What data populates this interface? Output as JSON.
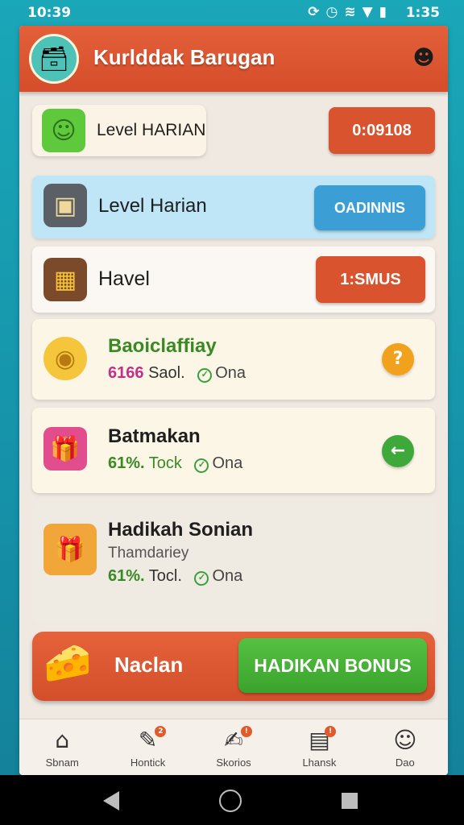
{
  "status_bar": {
    "time_left": "10:39",
    "time_right": "1:35",
    "icons": [
      "sync-icon",
      "alarm-icon",
      "wifi-icon",
      "signal-icon",
      "battery-icon"
    ]
  },
  "header": {
    "title": "Kurlddak Barugan",
    "logo_icon": "treasure-logo-icon",
    "profile_icon": "ninja-avatar-icon"
  },
  "row1": {
    "label": "Level HARIAN",
    "button": "0:09108",
    "icon": "green-cube-icon"
  },
  "row2": {
    "label": "Level Harian",
    "button": "OADINNIS",
    "icon": "tablet-icon"
  },
  "row3": {
    "label": "Havel",
    "button": "1:SMUS",
    "icon": "blocks-icon"
  },
  "cards": [
    {
      "title": "Baoiclaffiay",
      "subtitle": "",
      "pct": "6166",
      "pct_text": "Saol.",
      "status": "Ona",
      "action": "?",
      "icon": "golden-egg-icon"
    },
    {
      "title": "Batmakan",
      "subtitle": "",
      "pct": "61%.",
      "pct_text": "Tock",
      "status": "Ona",
      "action": "←",
      "icon": "gift-box-icon"
    },
    {
      "title": "Hadikah Sonian",
      "subtitle": "Thamdariey",
      "pct": "61%.",
      "pct_text": "Tocl.",
      "status": "Ona",
      "icon": "gift-pile-icon"
    }
  ],
  "banner": {
    "label": "Naclan",
    "button": "HADIKAN BONUS",
    "icon": "cheese-bonus-icon"
  },
  "bottom_nav": [
    {
      "label": "Sbnam",
      "icon": "home-icon"
    },
    {
      "label": "Hontick",
      "icon": "edit-box-icon",
      "badge": "2"
    },
    {
      "label": "Skorios",
      "icon": "edit-note-icon",
      "badge": "!"
    },
    {
      "label": "Lhansk",
      "icon": "calendar-icon",
      "badge": "!"
    },
    {
      "label": "Dao",
      "icon": "person-icon"
    }
  ],
  "colors": {
    "header": "#d85530",
    "accent_green": "#44ad35",
    "accent_blue": "#3b9fd6",
    "accent_orange": "#f2a11d"
  }
}
